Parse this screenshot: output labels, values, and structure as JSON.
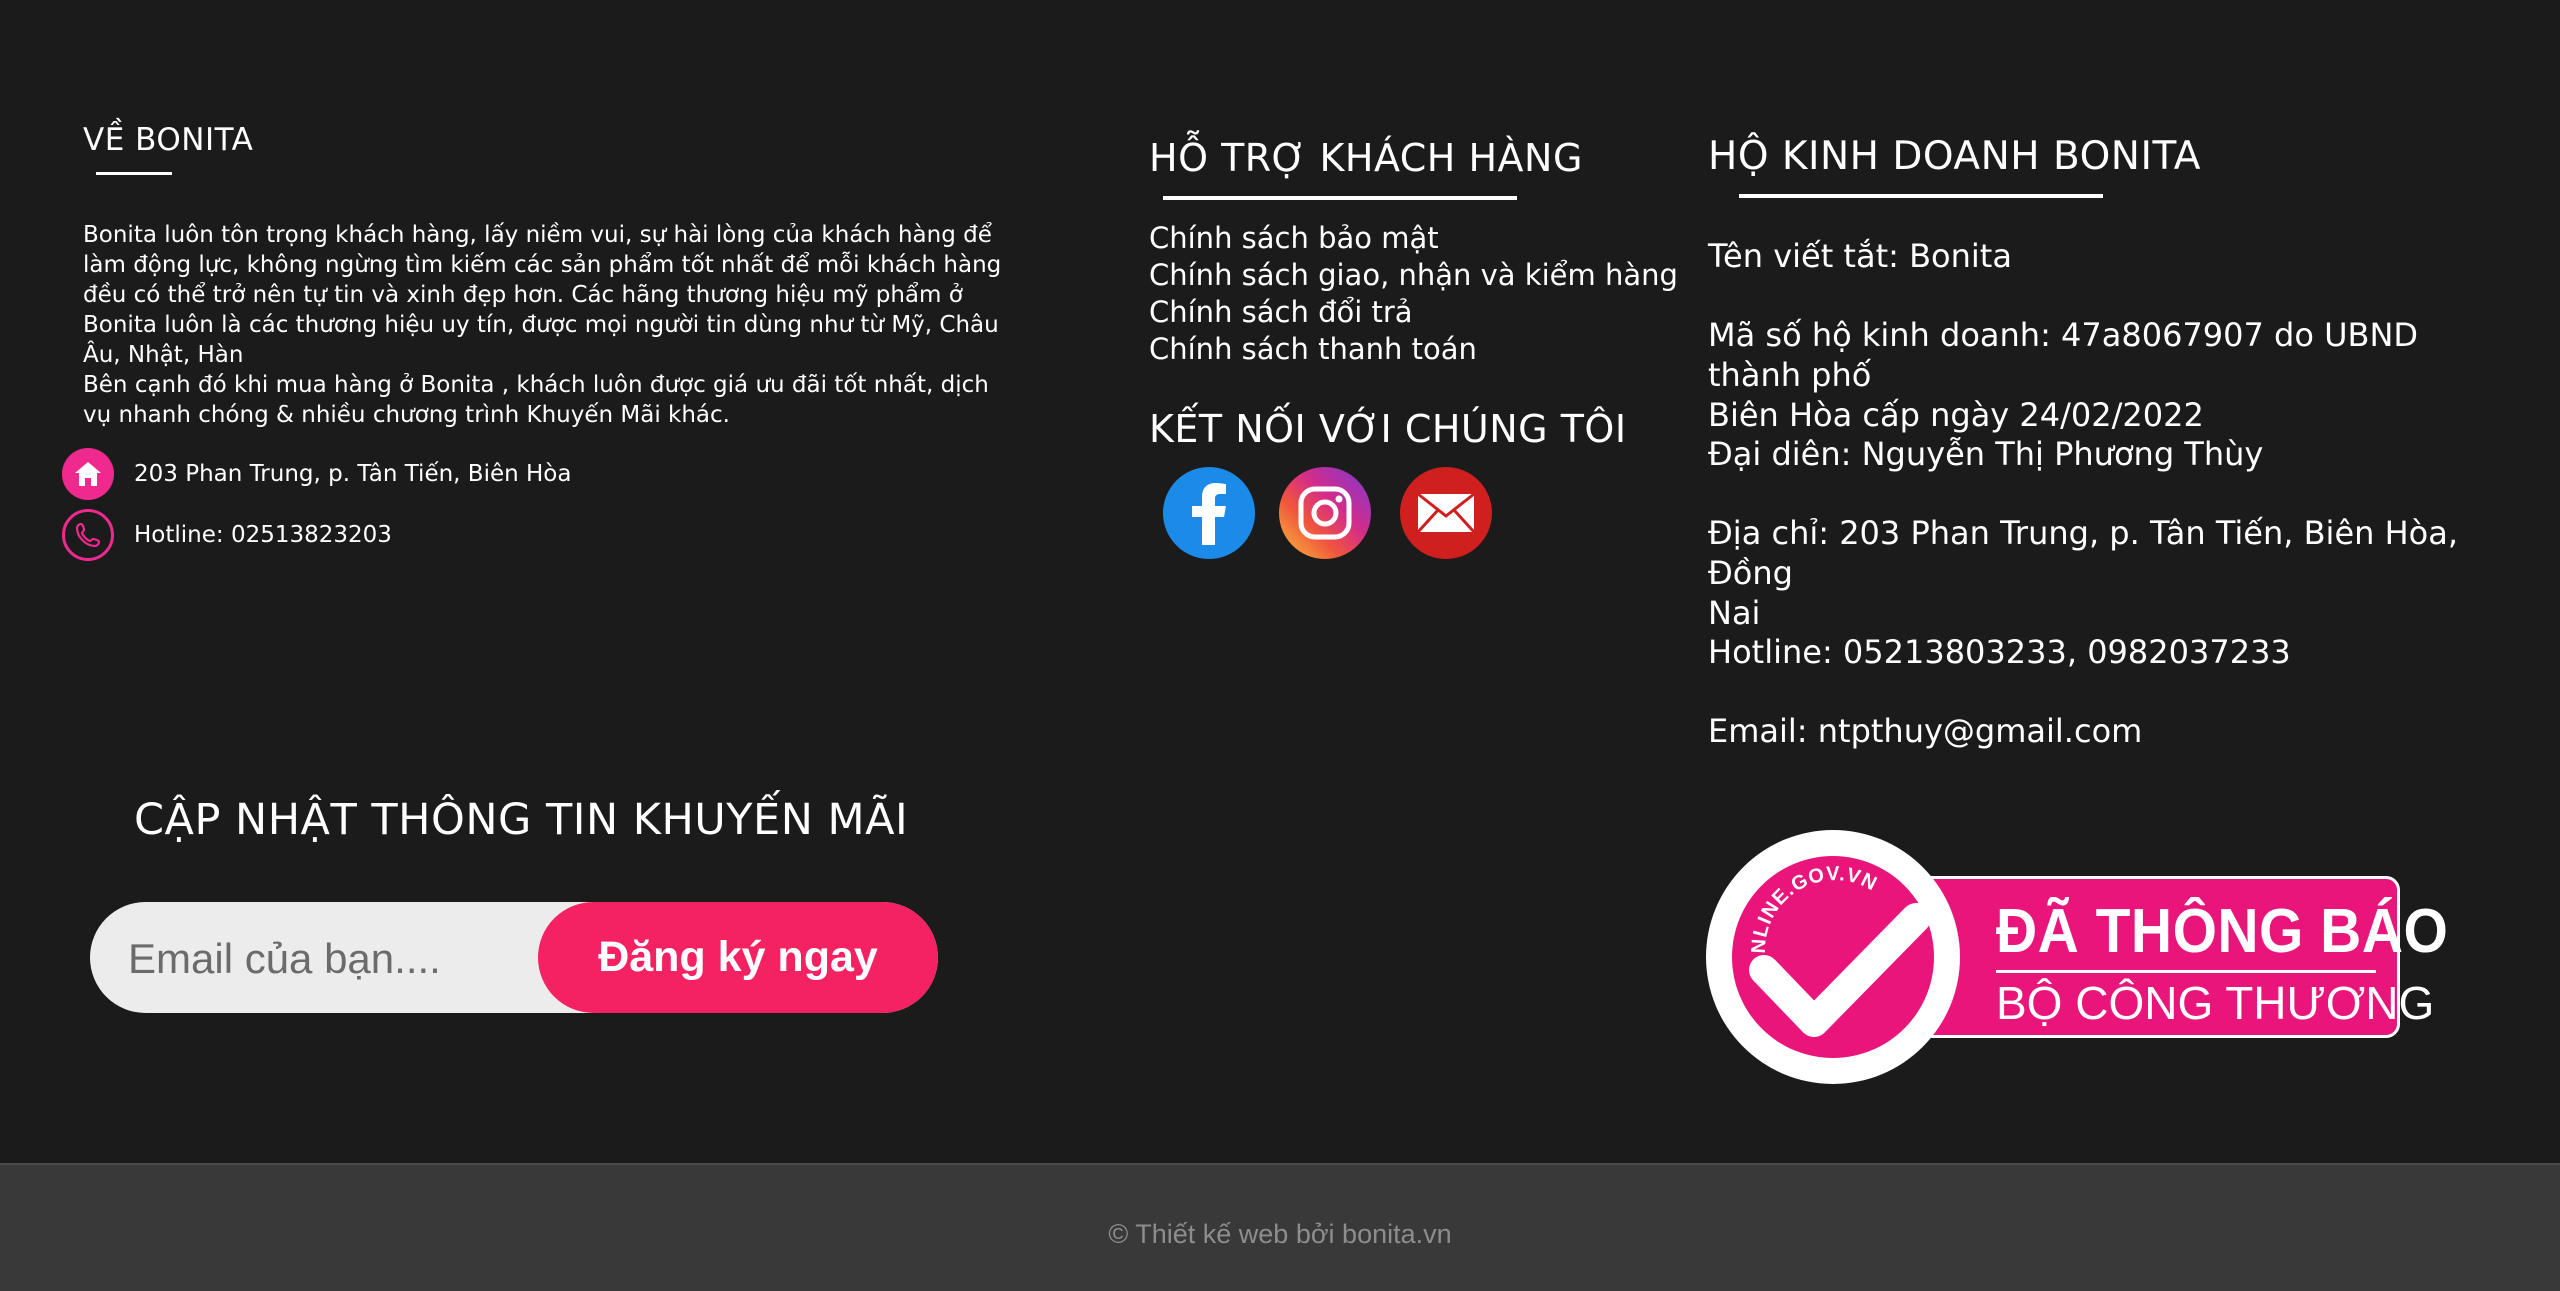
{
  "about": {
    "title": "VỀ BONITA",
    "paragraph1": "Bonita luôn tôn trọng khách hàng, lấy niềm vui, sự hài lòng của khách hàng để làm động lực, không ngừng tìm kiếm các sản phẩm tốt nhất để mỗi khách hàng đều có thể trở nên tự tin và xinh đẹp hơn. Các hãng thương hiệu mỹ phẩm ở Bonita luôn là các thương hiệu uy tín, được mọi người tin dùng như từ Mỹ, Châu Âu, Nhật, Hàn",
    "paragraph2": "Bên cạnh đó khi mua hàng ở Bonita , khách luôn được giá ưu đãi tốt nhất, dịch vụ nhanh chóng & nhiều chương trình Khuyến Mãi khác.",
    "address": "203 Phan Trung, p. Tân Tiến, Biên Hòa",
    "hotline": "Hotline: 02513823203"
  },
  "promo": {
    "title": "CẬP NHẬT THÔNG TIN KHUYẾN MÃI",
    "email_placeholder": "Email của bạn....",
    "button_label": "Đăng ký ngay"
  },
  "support": {
    "title": "HỖ TRỢ KHÁCH HÀNG",
    "links": [
      "Chính sách bảo mật",
      "Chính sách giao, nhận và kiểm hàng",
      "Chính sách đổi trả",
      "Chính sách thanh toán"
    ]
  },
  "connect": {
    "title": "KẾT NỐI VỚI CHÚNG TÔI",
    "icons": [
      "facebook-icon",
      "instagram-icon",
      "email-icon"
    ]
  },
  "business": {
    "title": "HỘ KINH DOANH BONITA",
    "short_name": "Tên viết tắt: Bonita",
    "license_line1": "Mã số hộ kinh doanh: 47a8067907 do UBND thành phố",
    "license_line2": "Biên Hòa cấp ngày 24/02/2022",
    "representative": "Đại diên: Nguyễn Thị Phương Thùy",
    "address_line1": "Địa chỉ: 203 Phan Trung, p. Tân Tiến, Biên Hòa, Đồng",
    "address_line2": "Nai",
    "hotline": "Hotline: 05213803233, 0982037233",
    "email": "Email: ntpthuy@gmail.com"
  },
  "badge": {
    "arc_text": "ONLINE.GOV.VN",
    "line1": "ĐÃ THÔNG BÁO",
    "line2": "BỘ CÔNG THƯƠNG"
  },
  "footer": {
    "copyright": "© Thiết kế web bởi bonita.vn"
  },
  "colors": {
    "background": "#1c1b1c",
    "accent_pink": "#f0298f",
    "button_pink": "#f52263",
    "badge_pink": "#e9157a",
    "bottom_bar": "#3a393a"
  }
}
